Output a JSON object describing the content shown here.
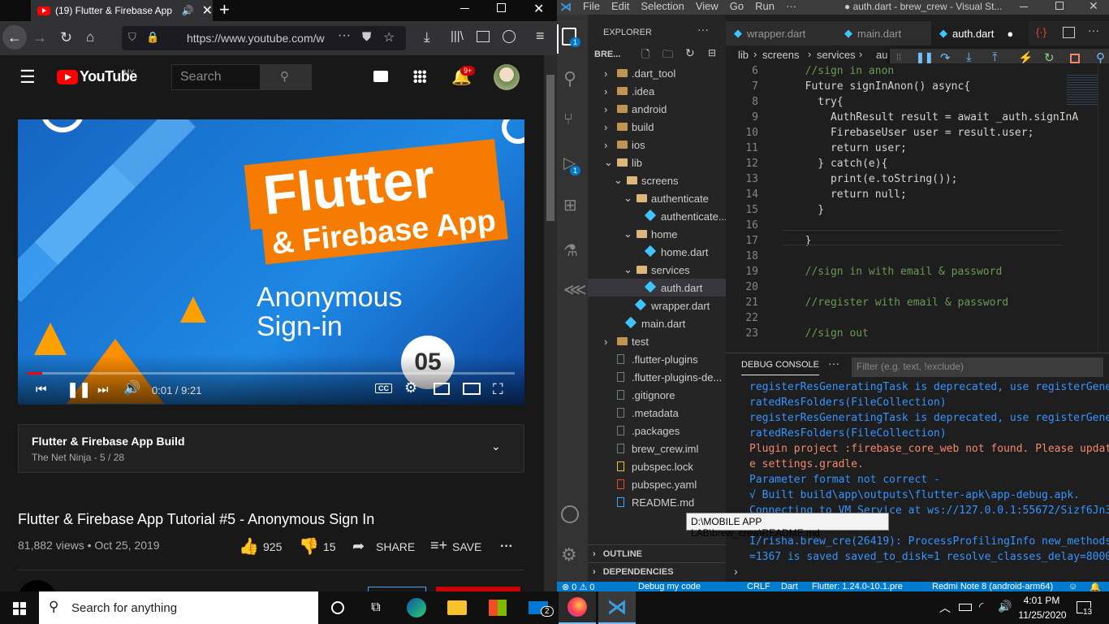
{
  "firefox": {
    "tab_title": "(19) Flutter & Firebase App",
    "url": "https://www.youtube.com/w"
  },
  "youtube": {
    "logo": "YouTube",
    "region": "MY",
    "search_placeholder": "Search",
    "notif_badge": "9+",
    "thumb_title1": "Flutter",
    "thumb_title2": "& Firebase App",
    "thumb_sub1": "Anonymous",
    "thumb_sub2": "Sign-in",
    "thumb_episode": "05",
    "time": "0:01 / 9:21",
    "cc_label": "CC",
    "progress": 0.03,
    "playlist_title": "Flutter & Firebase App Build",
    "playlist_sub": "The Net Ninja - 5 / 28",
    "video_title": "Flutter & Firebase App Tutorial #5 - Anonymous Sign In",
    "views": "81,882 views • Oct 25, 2019",
    "likes": "925",
    "dislikes": "15",
    "share": "SHARE",
    "save": "SAVE"
  },
  "vscode": {
    "menu": [
      "File",
      "Edit",
      "Selection",
      "View",
      "Go",
      "Run",
      "···"
    ],
    "window_title": "● auth.dart - brew_crew - Visual St...",
    "explorer_title": "EXPLORER",
    "explorer_root": "BRE...",
    "activity_badge1": "1",
    "activity_badge2": "1",
    "tree": [
      {
        "label": ".dart_tool",
        "indent": 0,
        "kind": "folder-closed"
      },
      {
        "label": ".idea",
        "indent": 0,
        "kind": "folder-closed"
      },
      {
        "label": "android",
        "indent": 0,
        "kind": "folder-closed"
      },
      {
        "label": "build",
        "indent": 0,
        "kind": "folder-closed"
      },
      {
        "label": "ios",
        "indent": 0,
        "kind": "folder-closed"
      },
      {
        "label": "lib",
        "indent": 0,
        "kind": "folder-open"
      },
      {
        "label": "screens",
        "indent": 1,
        "kind": "folder-open"
      },
      {
        "label": "authenticate",
        "indent": 2,
        "kind": "folder-open"
      },
      {
        "label": "authenticate....",
        "indent": 3,
        "kind": "dart"
      },
      {
        "label": "home",
        "indent": 2,
        "kind": "folder-open"
      },
      {
        "label": "home.dart",
        "indent": 3,
        "kind": "dart"
      },
      {
        "label": "services",
        "indent": 2,
        "kind": "folder-open"
      },
      {
        "label": "auth.dart",
        "indent": 3,
        "kind": "dart",
        "selected": true
      },
      {
        "label": "wrapper.dart",
        "indent": 2,
        "kind": "dart"
      },
      {
        "label": "main.dart",
        "indent": 1,
        "kind": "dart"
      },
      {
        "label": "test",
        "indent": 0,
        "kind": "folder-closed"
      },
      {
        "label": ".flutter-plugins",
        "indent": 0,
        "kind": "file"
      },
      {
        "label": ".flutter-plugins-de...",
        "indent": 0,
        "kind": "file"
      },
      {
        "label": ".gitignore",
        "indent": 0,
        "kind": "file"
      },
      {
        "label": ".metadata",
        "indent": 0,
        "kind": "file"
      },
      {
        "label": ".packages",
        "indent": 0,
        "kind": "file"
      },
      {
        "label": "brew_crew.iml",
        "indent": 0,
        "kind": "file"
      },
      {
        "label": "pubspec.lock",
        "indent": 0,
        "kind": "lock"
      },
      {
        "label": "pubspec.yaml",
        "indent": 0,
        "kind": "yaml"
      },
      {
        "label": "README.md",
        "indent": 0,
        "kind": "info"
      }
    ],
    "outline": "OUTLINE",
    "dependencies": "DEPENDENCIES",
    "tabs": [
      "wrapper.dart",
      "main.dart",
      "auth.dart"
    ],
    "breadcrumb": [
      "lib",
      "screens",
      "services",
      "au"
    ],
    "code": [
      {
        "n": "6",
        "t": "  //sign in anon"
      },
      {
        "n": "7",
        "t": "  Future signInAnon() async{"
      },
      {
        "n": "8",
        "t": "    try{"
      },
      {
        "n": "9",
        "t": "      AuthResult result = await _auth.signInA"
      },
      {
        "n": "10",
        "t": "      FirebaseUser user = result.user;"
      },
      {
        "n": "11",
        "t": "      return user;"
      },
      {
        "n": "12",
        "t": "    } catch(e){"
      },
      {
        "n": "13",
        "t": "      print(e.toString());"
      },
      {
        "n": "14",
        "t": "      return null;"
      },
      {
        "n": "15",
        "t": "    }"
      },
      {
        "n": "16",
        "t": ""
      },
      {
        "n": "17",
        "t": "  }"
      },
      {
        "n": "18",
        "t": ""
      },
      {
        "n": "19",
        "t": "  //sign in with email & password"
      },
      {
        "n": "20",
        "t": ""
      },
      {
        "n": "21",
        "t": "  //register with email & password"
      },
      {
        "n": "22",
        "t": ""
      },
      {
        "n": "23",
        "t": "  //sign out"
      }
    ],
    "debug_console": "DEBUG CONSOLE",
    "filter_placeholder": "Filter (e.g. text, !exclude)",
    "console": [
      {
        "t": "registerResGeneratingTask is deprecated, use registerGene",
        "c": "#3794ff"
      },
      {
        "t": "ratedResFolders(FileCollection)",
        "c": "#3794ff"
      },
      {
        "t": "registerResGeneratingTask is deprecated, use registerGene",
        "c": "#3794ff"
      },
      {
        "t": "ratedResFolders(FileCollection)",
        "c": "#3794ff"
      },
      {
        "t": "Plugin project :firebase_core_web not found. Please updat",
        "c": "#f48771"
      },
      {
        "t": "e settings.gradle.",
        "c": "#f48771"
      },
      {
        "t": "Parameter format not correct -",
        "c": "#3794ff"
      },
      {
        "t": "√ Built build\\app\\outputs\\flutter-apk\\app-debug.apk.",
        "c": "#3794ff"
      },
      {
        "t": "Connecting to VM Service at ws://127.0.0.1:55672/Sizf6Jn3",
        "c": "#3794ff"
      },
      {
        "t": "",
        "c": "#3794ff"
      },
      {
        "t": "I/risha.brew_cre(26419): ProcessProfilingInfo new_methods",
        "c": "#3794ff"
      },
      {
        "t": "=1367 is saved saved_to_disk=1 resolve_classes_delay=8000",
        "c": "#3794ff"
      }
    ],
    "tooltip": "D:\\MOBILE APP LAB\\brew_crew\\README.md",
    "status": {
      "problems": "⊗ 0 ⚠ 0",
      "debug": "Debug my code",
      "eol": "CRLF",
      "lang": "Dart",
      "flutter": "Flutter: 1.24.0-10.1.pre",
      "device": "Redmi Note 8 (android-arm64)"
    }
  },
  "taskbar": {
    "search": "Search for anything",
    "mail_badge": "2",
    "time": "4:01 PM",
    "date": "11/25/2020",
    "notif": "13"
  }
}
